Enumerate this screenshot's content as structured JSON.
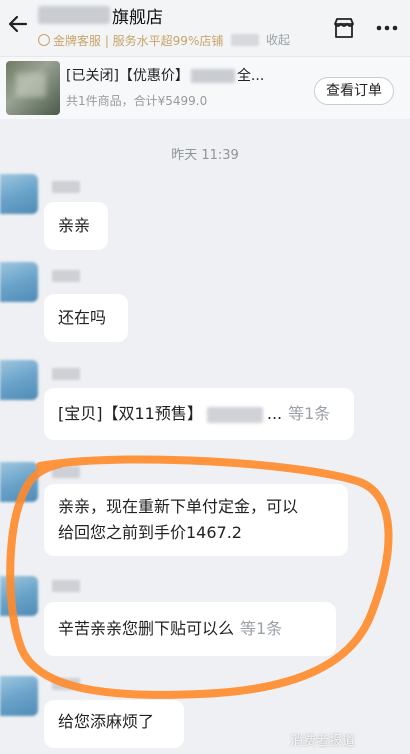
{
  "header": {
    "shop_name": "旗舰店",
    "badge_text": "金牌客服 | 服务水平超99%店铺",
    "collapse_label": "收起"
  },
  "order": {
    "title_prefix": "[已关闭]【优惠价】",
    "title_suffix": "全...",
    "subtitle": "共1件商品，合计¥5499.0",
    "view_button": "查看订单"
  },
  "timestamp": "昨天 11:39",
  "messages": [
    {
      "text": "亲亲"
    },
    {
      "text": "还在吗"
    },
    {
      "text": "[宝贝]【双11预售】",
      "suffix": "...",
      "count": "等1条"
    },
    {
      "line1": "亲亲，现在重新下单付定金，可以",
      "line2": "给回您之前到手价1467.2"
    },
    {
      "text": "辛苦亲亲您删下贴可以么",
      "count": "等1条"
    },
    {
      "text": "给您添麻烦了"
    }
  ],
  "colors": {
    "annotation_circle": "#ff8a2a",
    "gold_badge": "#c8a46a"
  },
  "watermark": "消费者报道"
}
